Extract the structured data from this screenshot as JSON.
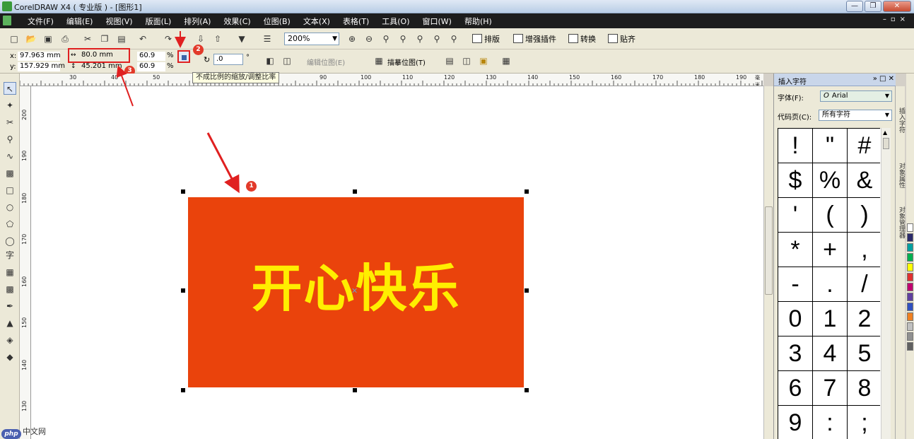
{
  "window": {
    "title": "CorelDRAW X4 ( 专业版 ) - [图形1]"
  },
  "menu": [
    "文件(F)",
    "编辑(E)",
    "视图(V)",
    "版面(L)",
    "排列(A)",
    "效果(C)",
    "位图(B)",
    "文本(X)",
    "表格(T)",
    "工具(O)",
    "窗口(W)",
    "帮助(H)"
  ],
  "toolbar": {
    "zoom": "200%",
    "buttons": [
      "排版",
      "增强插件",
      "转换",
      "贴齐"
    ]
  },
  "propbar": {
    "x_label": "x:",
    "x_value": "97.963 mm",
    "y_label": "y:",
    "y_value": "157.929 mm",
    "width_value": "80.0 mm",
    "height_value": "45.201 mm",
    "scale_w": "60.9",
    "scale_h": "60.9",
    "percent": "%",
    "rotation": ".0",
    "degree": "°",
    "edit_bitmap": "编辑位图(E)",
    "trace_bitmap": "描摹位图(T)"
  },
  "tooltip": "不成比例的缩放/调整比率",
  "badges": [
    "1",
    "2",
    "3"
  ],
  "ruler": {
    "top": [
      "30",
      "40",
      "50",
      "90",
      "100",
      "110",
      "120",
      "130",
      "140",
      "150",
      "160",
      "170",
      "180",
      "190"
    ],
    "unit": "毫米",
    "left": [
      "200",
      "190",
      "180",
      "170",
      "160",
      "150",
      "140",
      "130"
    ]
  },
  "canvas": {
    "text": "开心快乐",
    "rect_color": "#ea430c",
    "text_color": "#ffee00"
  },
  "docker": {
    "title": "插入字符",
    "font_label": "字体(F):",
    "font_value": "Arial",
    "codepage_label": "代码页(C):",
    "codepage_value": "所有字符",
    "chars": [
      "!",
      "\"",
      "#",
      "$",
      "%",
      "&",
      "'",
      "(",
      ")",
      "*",
      "+",
      ",",
      "-",
      ".",
      "/",
      "0",
      "1",
      "2",
      "3",
      "4",
      "5",
      "6",
      "7",
      "8",
      "9",
      ":",
      ";"
    ]
  },
  "side_tabs": [
    "插入字符",
    "对象属性",
    "对象管理器"
  ],
  "watermark": {
    "logo": "php",
    "text": "中文网"
  }
}
